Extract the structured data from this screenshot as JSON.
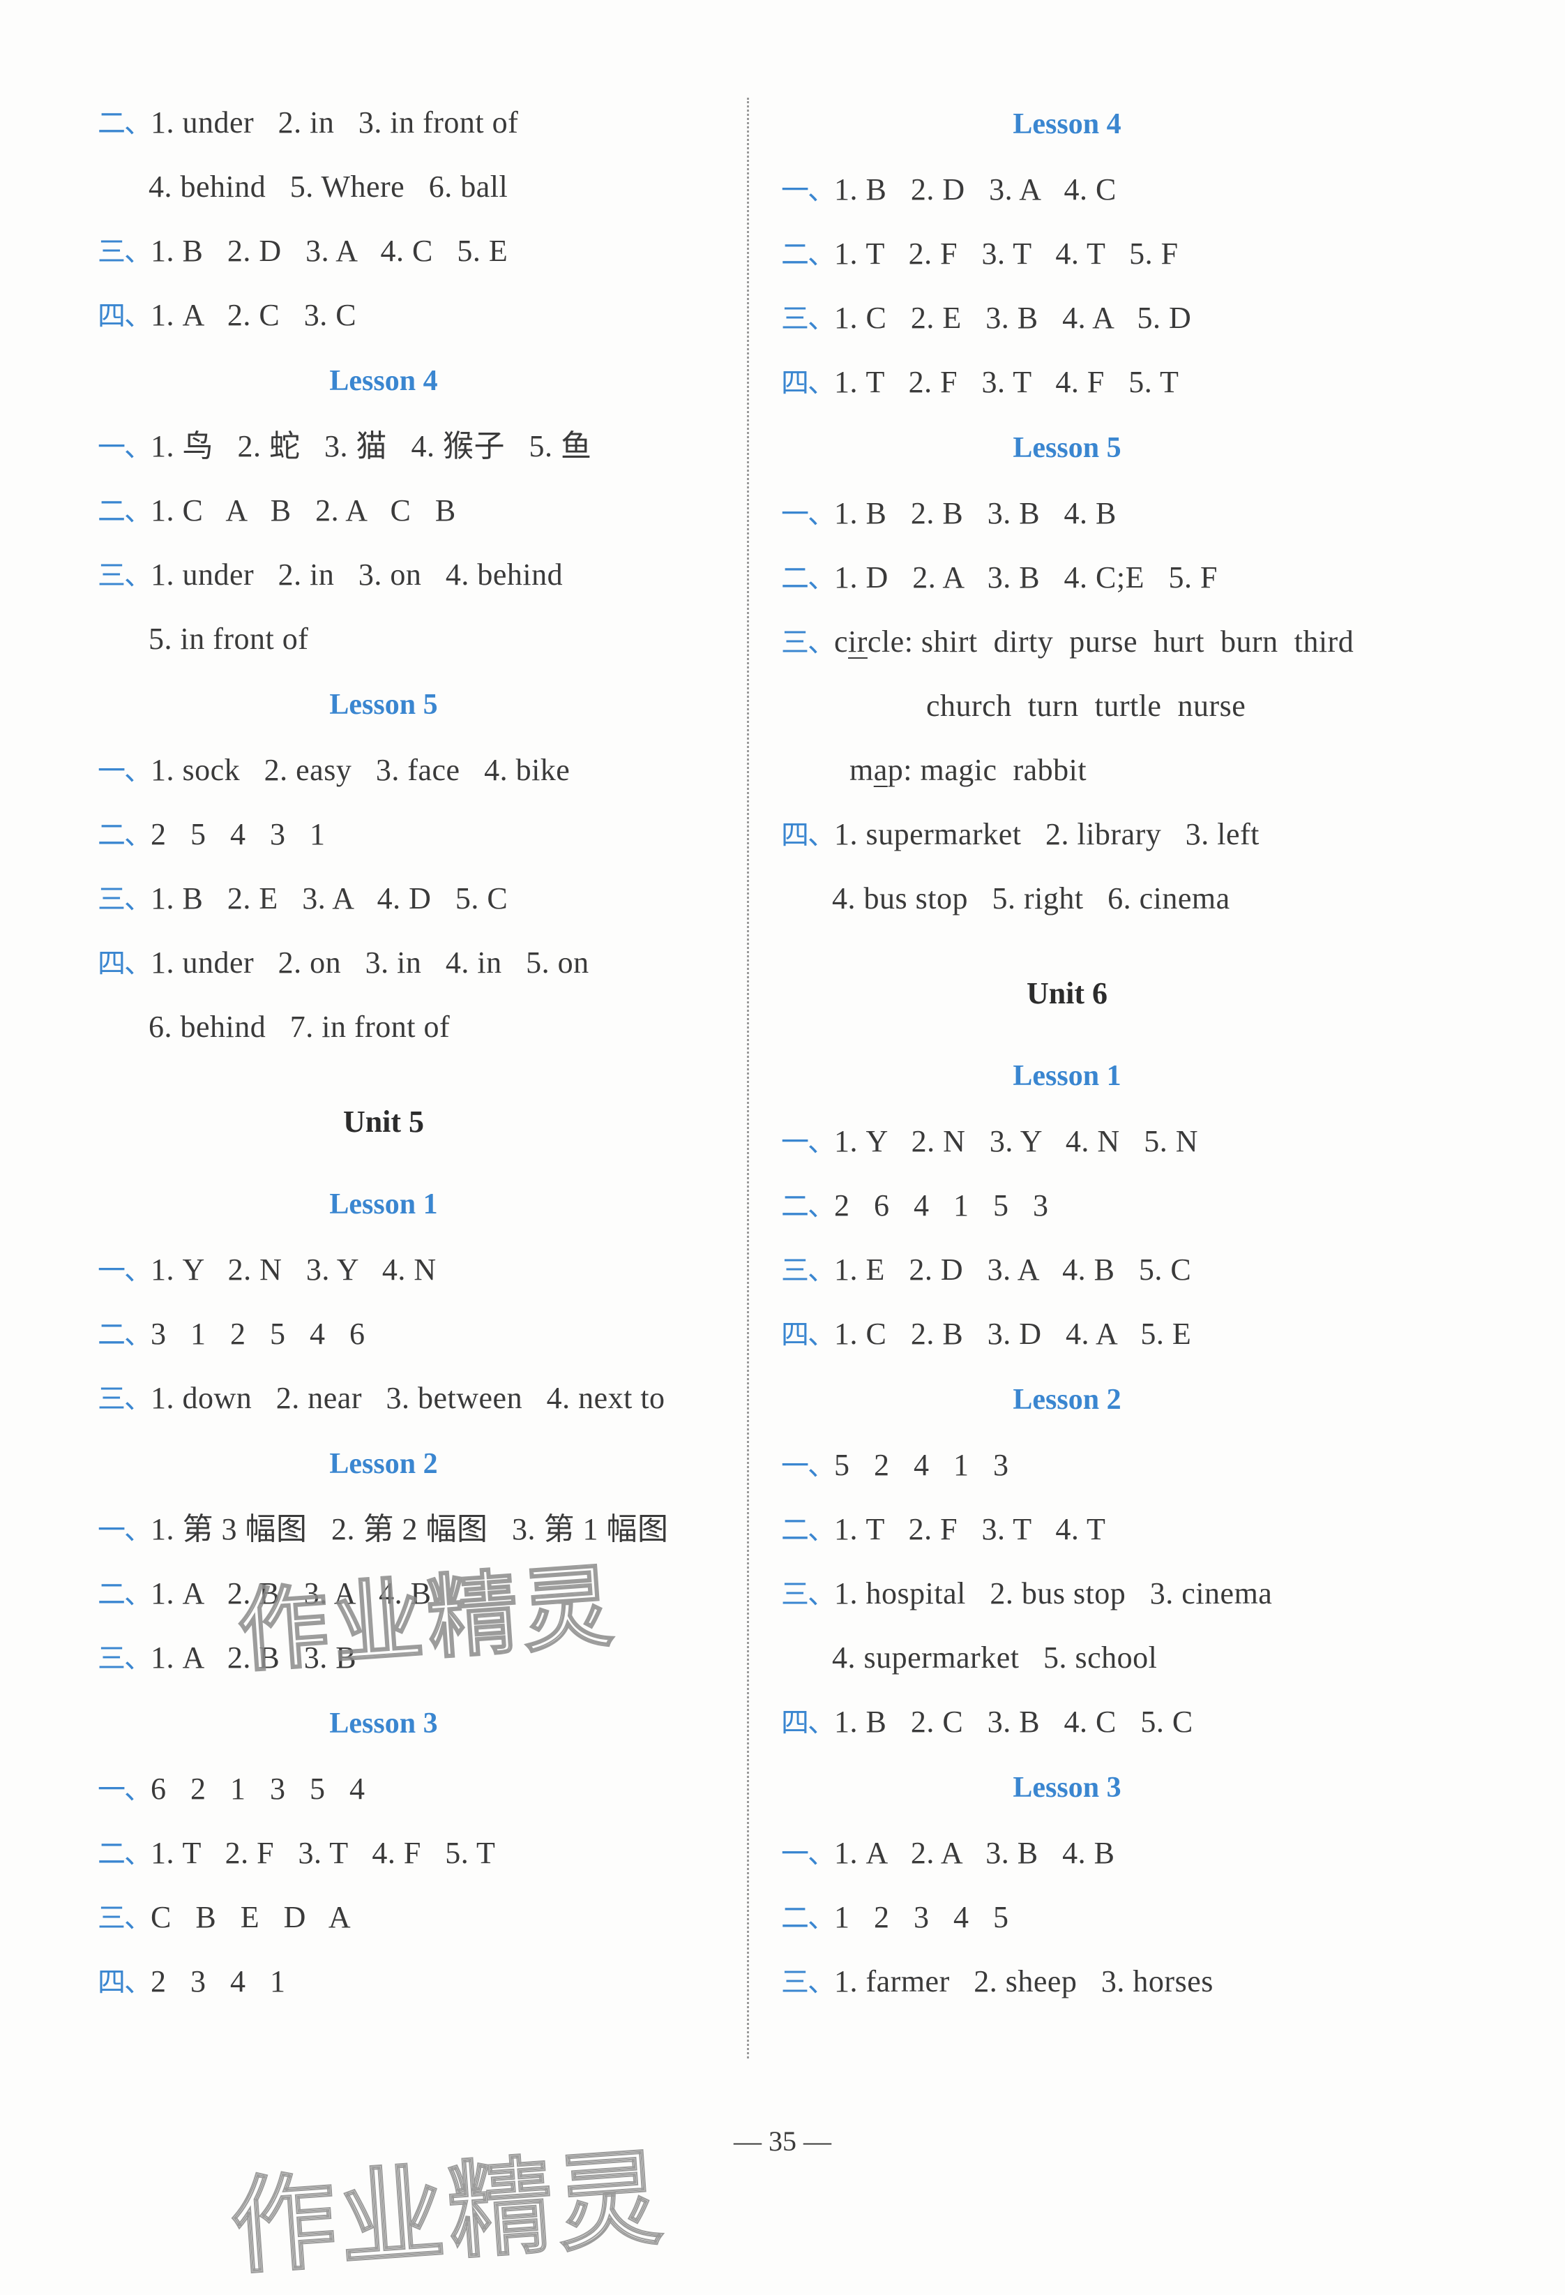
{
  "left_column": {
    "blocks": [
      {
        "type": "line",
        "num": "二、",
        "text": "1. under   2. in   3. in front of"
      },
      {
        "type": "cont",
        "text": "4. behind   5. Where   6. ball"
      },
      {
        "type": "line",
        "num": "三、",
        "text": "1. B   2. D   3. A   4. C   5. E"
      },
      {
        "type": "line",
        "num": "四、",
        "text": "1. A   2. C   3. C"
      },
      {
        "type": "lesson",
        "text": "Lesson 4"
      },
      {
        "type": "line",
        "num": "一、",
        "text": "1. 鸟   2. 蛇   3. 猫   4. 猴子   5. 鱼"
      },
      {
        "type": "line",
        "num": "二、",
        "text": "1. C   A   B   2. A   C   B"
      },
      {
        "type": "line",
        "num": "三、",
        "text": "1. under   2. in   3. on   4. behind"
      },
      {
        "type": "cont",
        "text": "5. in front of"
      },
      {
        "type": "lesson",
        "text": "Lesson 5"
      },
      {
        "type": "line",
        "num": "一、",
        "text": "1. sock   2. easy   3. face   4. bike"
      },
      {
        "type": "line",
        "num": "二、",
        "text": "2   5   4   3   1"
      },
      {
        "type": "line",
        "num": "三、",
        "text": "1. B   2. E   3. A   4. D   5. C"
      },
      {
        "type": "line",
        "num": "四、",
        "text": "1. under   2. on   3. in   4. in   5. on"
      },
      {
        "type": "cont",
        "text": "6. behind   7. in front of"
      },
      {
        "type": "unit",
        "text": "Unit 5"
      },
      {
        "type": "lesson",
        "text": "Lesson 1"
      },
      {
        "type": "line",
        "num": "一、",
        "text": "1. Y   2. N   3. Y   4. N"
      },
      {
        "type": "line",
        "num": "二、",
        "text": "3   1   2   5   4   6"
      },
      {
        "type": "line",
        "num": "三、",
        "text": "1. down   2. near   3. between   4. next to"
      },
      {
        "type": "lesson",
        "text": "Lesson 2"
      },
      {
        "type": "line",
        "num": "一、",
        "text": "1. 第 3 幅图   2. 第 2 幅图   3. 第 1 幅图"
      },
      {
        "type": "line",
        "num": "二、",
        "text": "1. A   2. B   3. A   4. B"
      },
      {
        "type": "line",
        "num": "三、",
        "text": "1. A   2. B   3. B"
      },
      {
        "type": "lesson",
        "text": "Lesson 3"
      },
      {
        "type": "line",
        "num": "一、",
        "text": "6   2   1   3   5   4"
      },
      {
        "type": "line",
        "num": "二、",
        "text": "1. T   2. F   3. T   4. F   5. T"
      },
      {
        "type": "line",
        "num": "三、",
        "text": "C   B   E   D   A"
      },
      {
        "type": "line",
        "num": "四、",
        "text": "2   3   4   1"
      }
    ]
  },
  "right_column": {
    "blocks": [
      {
        "type": "lesson",
        "text": "Lesson 4"
      },
      {
        "type": "line",
        "num": "一、",
        "text": "1. B   2. D   3. A   4. C"
      },
      {
        "type": "line",
        "num": "二、",
        "text": "1. T   2. F   3. T   4. T   5. F"
      },
      {
        "type": "line",
        "num": "三、",
        "text": "1. C   2. E   3. B   4. A   5. D"
      },
      {
        "type": "line",
        "num": "四、",
        "text": "1. T   2. F   3. T   4. F   5. T"
      },
      {
        "type": "lesson",
        "text": "Lesson 5"
      },
      {
        "type": "line",
        "num": "一、",
        "text": "1. B   2. B   3. B   4. B"
      },
      {
        "type": "line",
        "num": "二、",
        "text": "1. D   2. A   3. B   4. C;E   5. F"
      },
      {
        "type": "phonics",
        "num": "三、",
        "pre": "c",
        "ul": "ir",
        "post": "cle: shirt  dirty  purse  hurt  burn  third"
      },
      {
        "type": "cont2",
        "text": "church  turn  turtle  nurse"
      },
      {
        "type": "phonics3",
        "pre": "m",
        "ul": "a",
        "post": "p: magic  rabbit"
      },
      {
        "type": "line",
        "num": "四、",
        "text": "1. supermarket   2. library   3. left"
      },
      {
        "type": "cont",
        "text": "4. bus stop   5. right   6. cinema"
      },
      {
        "type": "unit",
        "text": "Unit 6"
      },
      {
        "type": "lesson",
        "text": "Lesson 1"
      },
      {
        "type": "line",
        "num": "一、",
        "text": "1. Y   2. N   3. Y   4. N   5. N"
      },
      {
        "type": "line",
        "num": "二、",
        "text": "2   6   4   1   5   3"
      },
      {
        "type": "line",
        "num": "三、",
        "text": "1. E   2. D   3. A   4. B   5. C"
      },
      {
        "type": "line",
        "num": "四、",
        "text": "1. C   2. B   3. D   4. A   5. E"
      },
      {
        "type": "lesson",
        "text": "Lesson 2"
      },
      {
        "type": "line",
        "num": "一、",
        "text": "5   2   4   1   3"
      },
      {
        "type": "line",
        "num": "二、",
        "text": "1. T   2. F   3. T   4. T"
      },
      {
        "type": "line",
        "num": "三、",
        "text": "1. hospital   2. bus stop   3. cinema"
      },
      {
        "type": "cont",
        "text": "4. supermarket   5. school"
      },
      {
        "type": "line",
        "num": "四、",
        "text": "1. B   2. C   3. B   4. C   5. C"
      },
      {
        "type": "lesson",
        "text": "Lesson 3"
      },
      {
        "type": "line",
        "num": "一、",
        "text": "1. A   2. A   3. B   4. B"
      },
      {
        "type": "line",
        "num": "二、",
        "text": "1   2   3   4   5"
      },
      {
        "type": "line",
        "num": "三、",
        "text": "1. farmer   2. sheep   3. horses"
      }
    ]
  },
  "footer": {
    "page_number": "— 35 —"
  },
  "watermark": {
    "text": "作业精灵"
  },
  "colors": {
    "accent_blue": "#3a86d0",
    "text": "#3a3a3a",
    "unit_heading": "#2c2c2c"
  }
}
